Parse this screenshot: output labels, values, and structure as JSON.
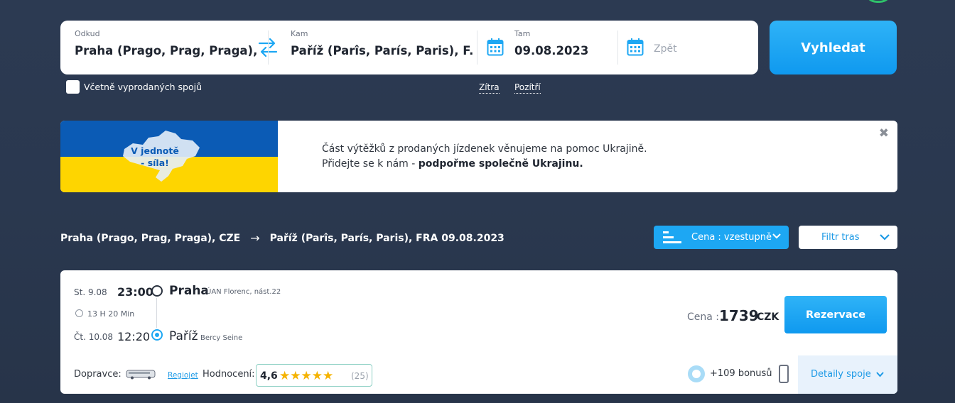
{
  "search": {
    "from_label": "Odkud",
    "from_value": "Praha (Prago,  Prag,  Praga), C..",
    "to_label": "Kam",
    "to_value": "Paříž (Parîs,  París,  Paris), F...",
    "there_label": "Tam",
    "there_value": "09.08.2023",
    "back_placeholder": "Zpět",
    "search_button": "Vyhledat",
    "include_soldout": "Včetně vyprodaných spojů",
    "tomorrow": "Zítra",
    "day_after": "Pozítří"
  },
  "banner": {
    "flag_text": "V jednotě - síla!",
    "line1": "Část výtěžků z prodaných jízdenek věnujeme na pomoc Ukrajině.",
    "line2_prefix": "Přidejte se k nám - ",
    "line2_bold": "podpořme společně Ukrajinu."
  },
  "route": {
    "from": "Praha (Prago, Prag, Praga), CZE",
    "to": "Paříž (Parîs, París, Paris), FRA 09.08.2023"
  },
  "sort": {
    "label": "Cena : vzestupně"
  },
  "filter": {
    "label": "Filtr tras"
  },
  "result": {
    "dep_date": "St. 9.08",
    "dep_time": "23:00",
    "dep_city": "Praha",
    "dep_station": "ÚAN Florenc, nást.22",
    "duration": "13 H 20 Min",
    "arr_date": "Čt. 10.08",
    "arr_time": "12:20",
    "arr_city": "Paříž",
    "arr_station": "Bercy Seine",
    "price_label": "Cena :",
    "price": "1739",
    "currency": "CZK",
    "reserve_button": "Rezervace",
    "carrier_label": "Dopravce:",
    "carrier_name": "Regiojet",
    "rating_label": "Hodnocení:",
    "rating": "4,6",
    "rating_count": "(25)",
    "bonus": "+109 bonusů",
    "details": "Detaily spoje"
  },
  "colors": {
    "accent": "#1da7f3",
    "background": "#2a384f",
    "ukraine_blue": "#0b5bb5",
    "ukraine_yellow": "#fed500",
    "star": "#f5b301"
  }
}
